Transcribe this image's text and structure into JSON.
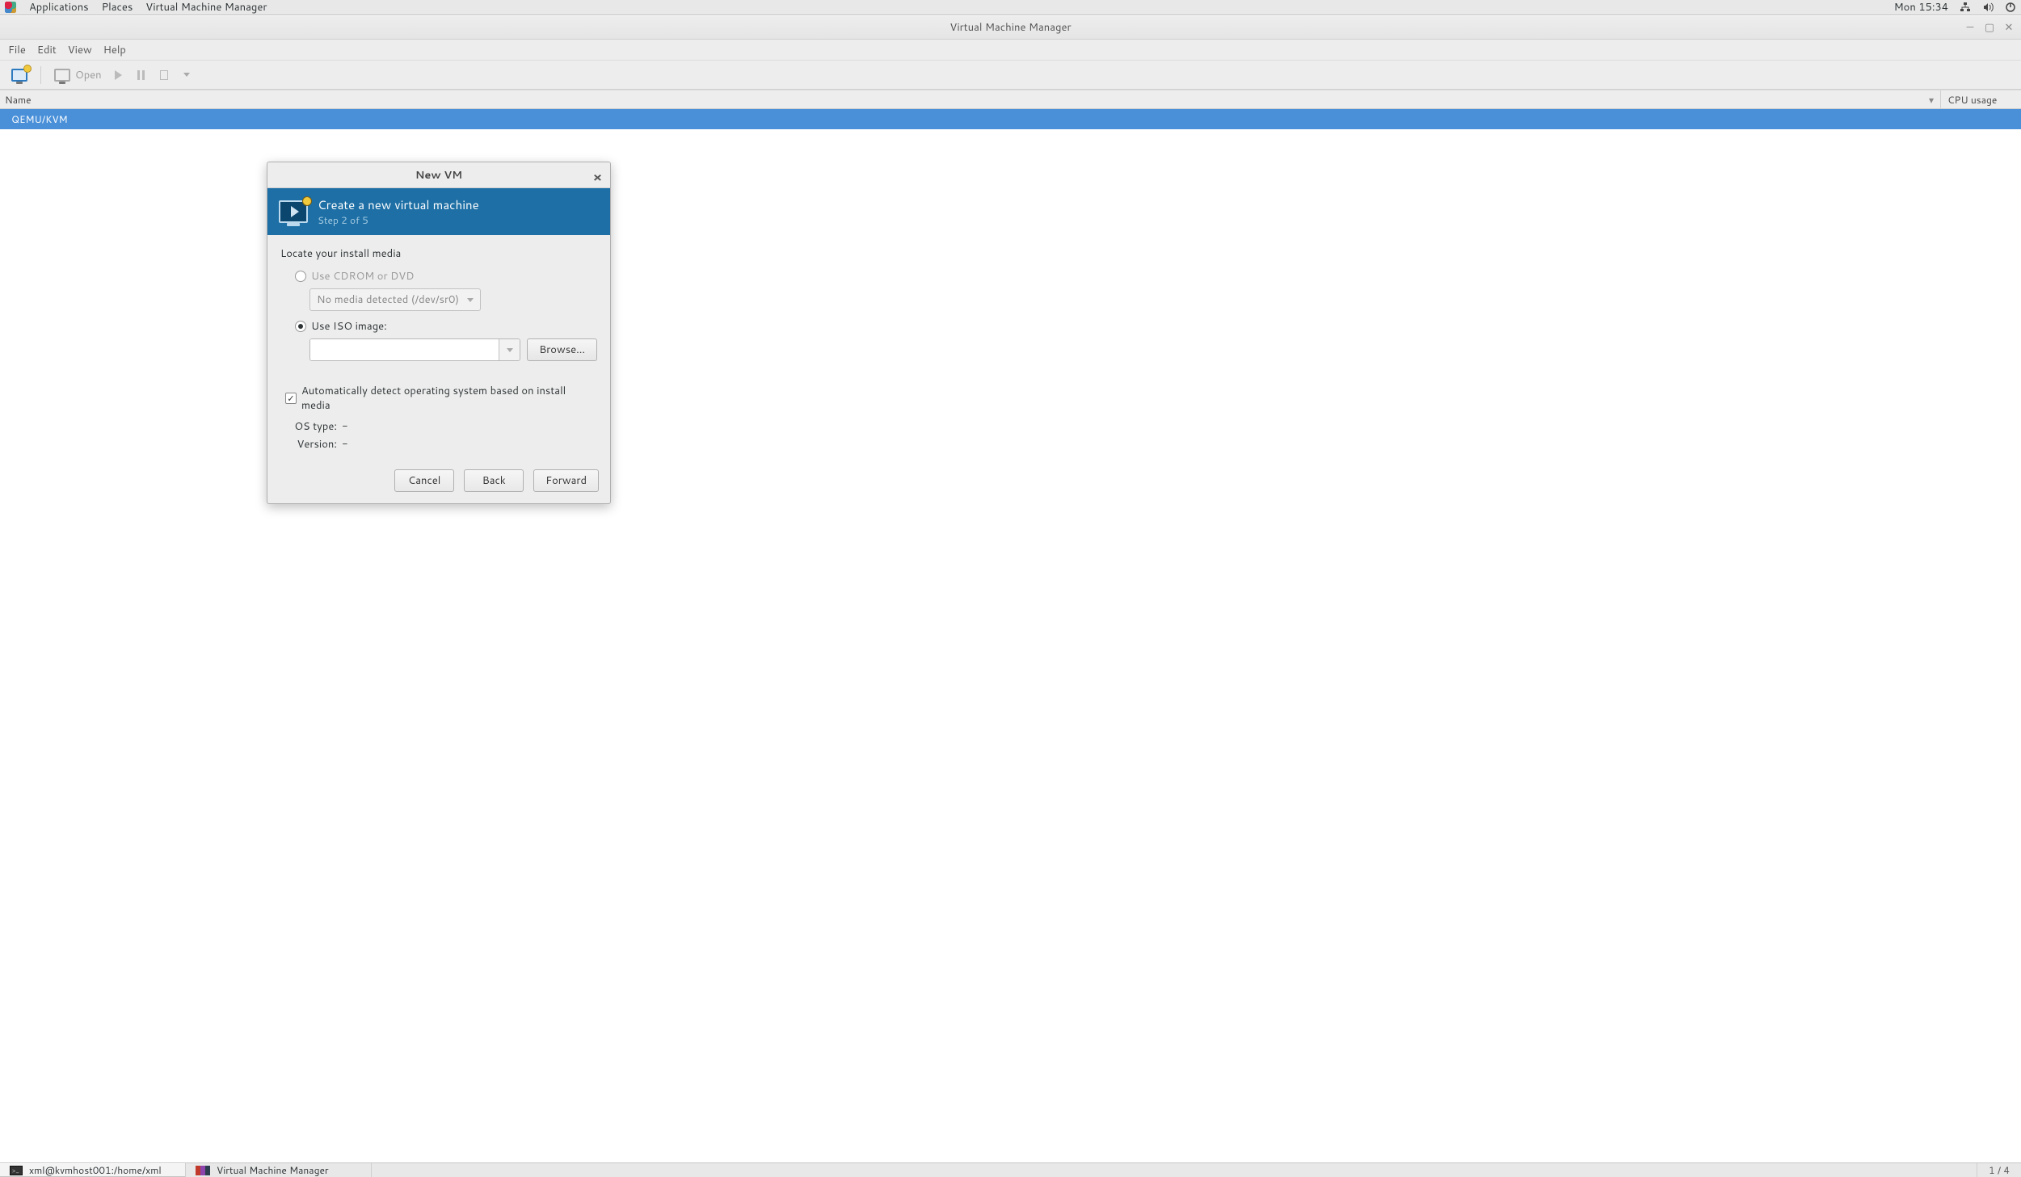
{
  "topbar": {
    "applications": "Applications",
    "places": "Places",
    "active_app": "Virtual Machine Manager",
    "clock": "Mon 15:34"
  },
  "vmm": {
    "title": "Virtual Machine Manager",
    "menus": {
      "file": "File",
      "edit": "Edit",
      "view": "View",
      "help": "Help"
    },
    "toolbar": {
      "open": "Open"
    },
    "columns": {
      "name": "Name",
      "cpu": "CPU usage"
    },
    "group": "QEMU/KVM"
  },
  "dialog": {
    "title": "New VM",
    "header_title": "Create a new virtual machine",
    "header_sub": "Step 2 of 5",
    "section": "Locate your install media",
    "opt_cdrom": "Use CDROM or DVD",
    "cdrom_value": "No media detected (/dev/sr0)",
    "opt_iso": "Use ISO image:",
    "iso_value": "",
    "browse": "Browse...",
    "autodetect": "Automatically detect operating system based on install media",
    "os_type_label": "OS type:",
    "os_type_value": "-",
    "version_label": "Version:",
    "version_value": "-",
    "btn_cancel": "Cancel",
    "btn_back": "Back",
    "btn_forward": "Forward"
  },
  "taskbar": {
    "terminal": "xml@kvmhost001:/home/xml",
    "vmm": "Virtual Machine Manager",
    "workspace": "1 / 4"
  }
}
